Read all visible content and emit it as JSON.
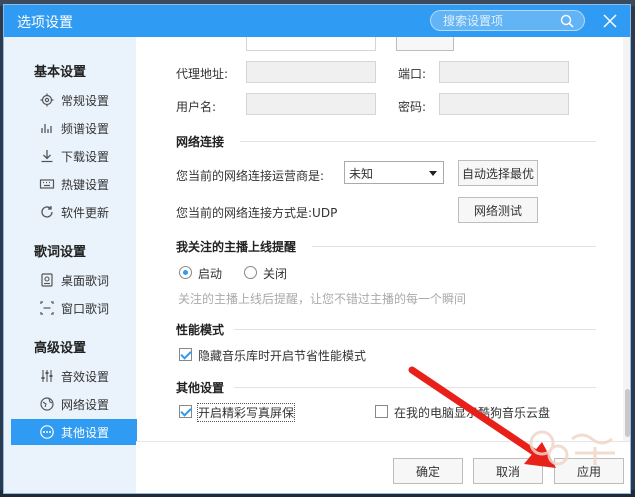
{
  "window": {
    "title": "选项设置",
    "search_placeholder": "搜索设置项"
  },
  "sidebar": {
    "sections": [
      {
        "title": "基本设置"
      },
      {
        "title": "歌词设置"
      },
      {
        "title": "高级设置"
      }
    ],
    "items": [
      {
        "label": "常规设置",
        "icon": "gear-icon"
      },
      {
        "label": "频谱设置",
        "icon": "spectrum-icon"
      },
      {
        "label": "下载设置",
        "icon": "download-icon"
      },
      {
        "label": "热键设置",
        "icon": "keyboard-icon"
      },
      {
        "label": "软件更新",
        "icon": "update-icon"
      },
      {
        "label": "桌面歌词",
        "icon": "desktop-lyrics-icon"
      },
      {
        "label": "窗口歌词",
        "icon": "window-lyrics-icon"
      },
      {
        "label": "音效设置",
        "icon": "equalizer-icon"
      },
      {
        "label": "网络设置",
        "icon": "globe-icon"
      },
      {
        "label": "其他设置",
        "icon": "more-icon"
      }
    ],
    "active_item": "其他设置"
  },
  "proxy": {
    "address_label": "代理地址:",
    "port_label": "端口:",
    "username_label": "用户名:",
    "password_label": "密码:"
  },
  "network": {
    "title": "网络连接",
    "isp_label": "您当前的网络连接运营商是:",
    "isp_value": "未知",
    "auto_select_button": "自动选择最优",
    "mode_label": "您当前的网络连接方式是:UDP",
    "test_button": "网络测试"
  },
  "host_alert": {
    "title": "我关注的主播上线提醒",
    "option_on": "启动",
    "option_off": "关闭",
    "selected": "启动",
    "hint": "关注的主播上线后提醒，让您不错过主播的每一个瞬间"
  },
  "performance": {
    "title": "性能模式",
    "checkbox_label": "隐藏音乐库时开启节省性能模式",
    "checked": true
  },
  "other": {
    "title": "其他设置",
    "screensaver_label": "开启精彩写真屏保",
    "screensaver_checked": true,
    "cloud_label": "在我的电脑显示酷狗音乐云盘",
    "cloud_checked": false
  },
  "footer": {
    "ok": "确定",
    "cancel": "取消",
    "apply": "应用"
  },
  "colors": {
    "accent": "#2f9bf2",
    "arrow": "#e8201a"
  }
}
